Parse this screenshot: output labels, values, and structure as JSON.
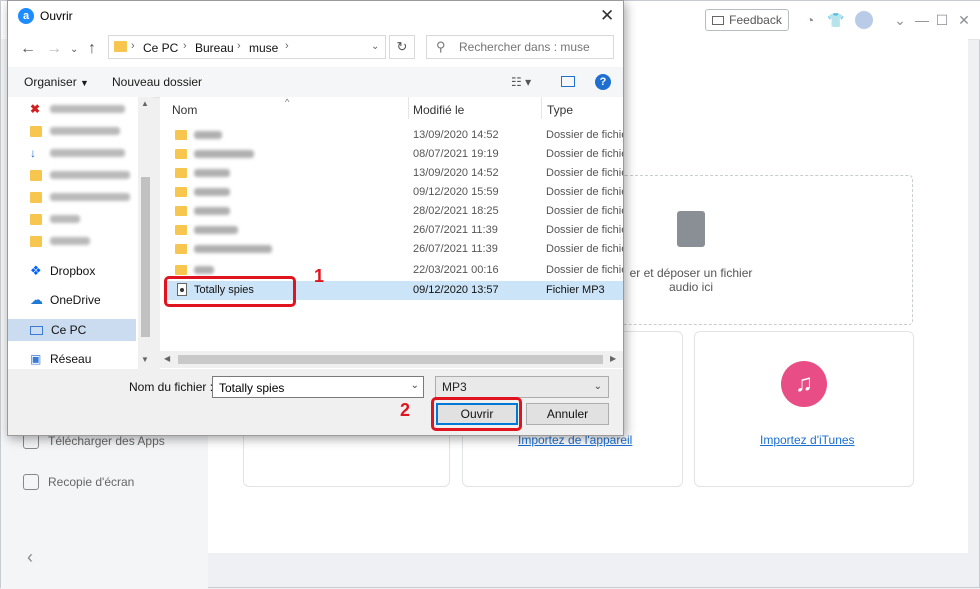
{
  "app": {
    "feedback_label": "Feedback",
    "drop_text": "er et déposer un fichier audio ici",
    "import_device_link": "Importez de l'appareil",
    "import_itunes_link": "Importez d'iTunes",
    "sidebar": [
      {
        "label": "Télécharger des Apps"
      },
      {
        "label": "Recopie d'écran"
      }
    ],
    "collapse_arrow": "‹"
  },
  "dialog": {
    "title": "Ouvrir",
    "breadcrumb": [
      "Ce PC",
      "Bureau",
      "muse"
    ],
    "search_placeholder": "Rechercher dans : muse",
    "toolbar": {
      "organize": "Organiser",
      "new_folder": "Nouveau dossier"
    },
    "nav_items": [
      "Dropbox",
      "OneDrive",
      "Ce PC",
      "Réseau"
    ],
    "columns": {
      "name": "Nom",
      "modified": "Modifié le",
      "type": "Type"
    },
    "files": [
      {
        "date": "13/09/2020 14:52",
        "type": "Dossier de fichiers"
      },
      {
        "date": "08/07/2021 19:19",
        "type": "Dossier de fichiers"
      },
      {
        "date": "13/09/2020 14:52",
        "type": "Dossier de fichiers"
      },
      {
        "date": "09/12/2020 15:59",
        "type": "Dossier de fichiers"
      },
      {
        "date": "28/02/2021 18:25",
        "type": "Dossier de fichiers"
      },
      {
        "date": "26/07/2021 11:39",
        "type": "Dossier de fichiers"
      },
      {
        "date": "26/07/2021 11:39",
        "type": "Dossier de fichiers"
      },
      {
        "date": "22/03/2021 00:16",
        "type": "Dossier de fichiers"
      },
      {
        "name": "Totally spies",
        "date": "09/12/2020 13:57",
        "type": "Fichier MP3"
      }
    ],
    "filename_label": "Nom du fichier :",
    "filename_value": "Totally spies",
    "filetype_value": "MP3",
    "open_button": "Ouvrir",
    "cancel_button": "Annuler"
  },
  "annotations": {
    "step1": "1",
    "step2": "2"
  },
  "colors": {
    "accent": "#0078d7",
    "annotation": "#e0141e",
    "folder": "#f6c64f",
    "link": "#1a6fd1"
  }
}
